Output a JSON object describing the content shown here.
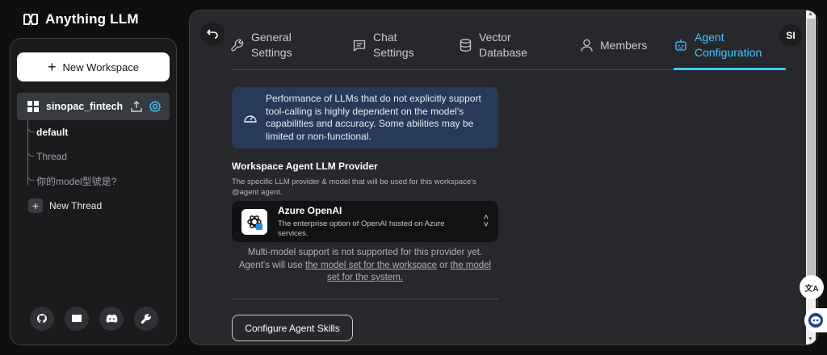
{
  "app": {
    "title": "Anything LLM"
  },
  "sidebar": {
    "new_workspace_label": "New Workspace",
    "workspace": {
      "name": "sinopac_fintech"
    },
    "threads": [
      {
        "label": "default",
        "active": true
      },
      {
        "label": "Thread",
        "active": false
      },
      {
        "label": "你的model型號是?",
        "active": false
      }
    ],
    "new_thread_label": "New Thread",
    "footer_icons": [
      "github-icon",
      "book-icon",
      "discord-icon",
      "wrench-icon"
    ]
  },
  "tabs": [
    {
      "id": "general",
      "label": "General Settings",
      "icon": "wrench-icon"
    },
    {
      "id": "chat",
      "label": "Chat Settings",
      "icon": "chat-icon"
    },
    {
      "id": "vector",
      "label": "Vector Database",
      "icon": "database-icon"
    },
    {
      "id": "members",
      "label": "Members",
      "icon": "user-icon"
    },
    {
      "id": "agent",
      "label": "Agent Configuration",
      "icon": "robot-icon",
      "active": true
    }
  ],
  "user": {
    "initials": "SI"
  },
  "notice": {
    "text": "Performance of LLMs that do not explicitly support tool-calling is highly dependent on the model's capabilities and accuracy. Some abilities may be limited or non-functional."
  },
  "agent_provider": {
    "title": "Workspace Agent LLM Provider",
    "description": "The specific LLM provider & model that will be used for this workspace's @agent agent.",
    "selected": {
      "name": "Azure OpenAI",
      "description": "The enterprise option of OpenAI hosted on Azure services."
    },
    "multi_model_note": "Multi-model support is not supported for this provider yet.",
    "note_prefix": "Agent's will use",
    "note_link1": "the model set for the workspace",
    "note_or": "or",
    "note_link2": "the model set for the system."
  },
  "configure_skills_label": "Configure Agent Skills",
  "colors": {
    "accent": "#46c8ff",
    "notice_bg": "#283a5a",
    "sidebar_bg": "#1b1b1e",
    "main_bg": "#27282b"
  }
}
